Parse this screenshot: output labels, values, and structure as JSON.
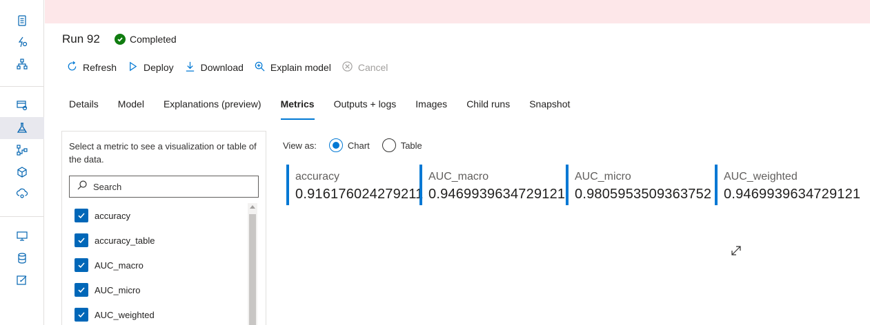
{
  "rail": {
    "icons": [
      "notebook-icon",
      "automl-icon",
      "designer-icon",
      "datasets-icon",
      "experiments-icon",
      "pipelines-icon",
      "models-icon",
      "endpoints-icon",
      "compute-icon",
      "datastores-icon",
      "data-labeling-icon"
    ],
    "active": "experiments-icon"
  },
  "header": {
    "run_title": "Run 92",
    "status_label": "Completed",
    "status_color": "#107c10"
  },
  "toolbar": {
    "refresh_label": "Refresh",
    "deploy_label": "Deploy",
    "download_label": "Download",
    "explain_label": "Explain model",
    "cancel_label": "Cancel"
  },
  "tabs": [
    {
      "label": "Details"
    },
    {
      "label": "Model"
    },
    {
      "label": "Explanations (preview)"
    },
    {
      "label": "Metrics",
      "active": true
    },
    {
      "label": "Outputs + logs"
    },
    {
      "label": "Images"
    },
    {
      "label": "Child runs"
    },
    {
      "label": "Snapshot"
    }
  ],
  "metric_panel": {
    "description": "Select a metric to see a visualization or table of the data.",
    "search_placeholder": "Search",
    "items": [
      {
        "label": "accuracy",
        "checked": true
      },
      {
        "label": "accuracy_table",
        "checked": true
      },
      {
        "label": "AUC_macro",
        "checked": true
      },
      {
        "label": "AUC_micro",
        "checked": true
      },
      {
        "label": "AUC_weighted",
        "checked": true
      }
    ]
  },
  "view_as": {
    "label": "View as:",
    "chart_label": "Chart",
    "table_label": "Table",
    "selected": "Chart"
  },
  "metrics": [
    {
      "name": "accuracy",
      "value": "0.916176024279211"
    },
    {
      "name": "AUC_macro",
      "value": "0.9469939634729121"
    },
    {
      "name": "AUC_micro",
      "value": "0.9805953509363752"
    },
    {
      "name": "AUC_weighted",
      "value": "0.9469939634729121"
    }
  ],
  "colors": {
    "accent": "#0078d4",
    "banner": "#fde7e9",
    "checkbox": "#0067b8"
  }
}
